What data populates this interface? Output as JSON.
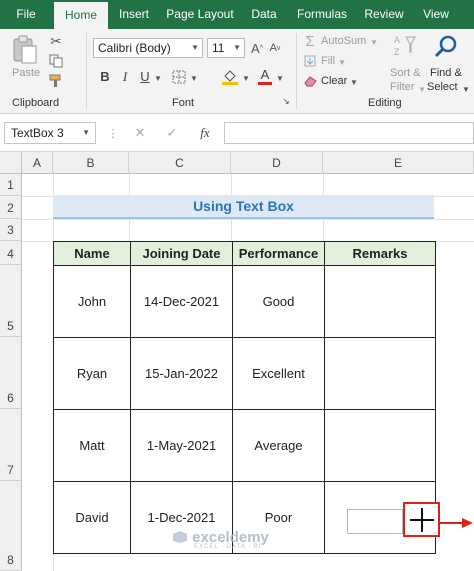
{
  "tabs": [
    {
      "label": "File",
      "active": false
    },
    {
      "label": "Home",
      "active": true
    },
    {
      "label": "Insert",
      "active": false
    },
    {
      "label": "Page Layout",
      "active": false
    },
    {
      "label": "Data",
      "active": false
    },
    {
      "label": "Formulas",
      "active": false
    },
    {
      "label": "Review",
      "active": false
    },
    {
      "label": "View",
      "active": false
    }
  ],
  "ribbon": {
    "clipboard": {
      "paste": "Paste",
      "label": "Clipboard"
    },
    "font": {
      "family": "Calibri (Body)",
      "size": "11",
      "label": "Font",
      "bold": "B",
      "italic": "I",
      "underline": "U"
    },
    "editing": {
      "autosum": "AutoSum",
      "fill": "Fill",
      "clear": "Clear",
      "sort": "Sort &",
      "filter": "Filter",
      "find": "Find &",
      "select": "Select",
      "label": "Editing"
    }
  },
  "formula_bar": {
    "name_box": "TextBox 3",
    "fx": "fx",
    "cancel": "✕",
    "enter": "✓"
  },
  "columns": [
    "A",
    "B",
    "C",
    "D",
    "E"
  ],
  "rows": [
    "1",
    "2",
    "3",
    "4",
    "5",
    "6",
    "7",
    "8"
  ],
  "sheet": {
    "title": "Using Text Box",
    "headers": [
      "Name",
      "Joining Date",
      "Performance",
      "Remarks"
    ],
    "records": [
      [
        "John",
        "14-Dec-2021",
        "Good",
        ""
      ],
      [
        "Ryan",
        "15-Jan-2022",
        "Excellent",
        ""
      ],
      [
        "Matt",
        "1-May-2021",
        "Average",
        ""
      ],
      [
        "David",
        "1-Dec-2021",
        "Poor",
        ""
      ]
    ]
  },
  "watermark": {
    "brand": "exceldemy",
    "tagline": "EXCEL · DATA · BI"
  },
  "colors": {
    "excel_green": "#217346",
    "title_blue": "#2e75b6",
    "header_green": "#e2efda",
    "highlight_red": "#e0201b"
  }
}
